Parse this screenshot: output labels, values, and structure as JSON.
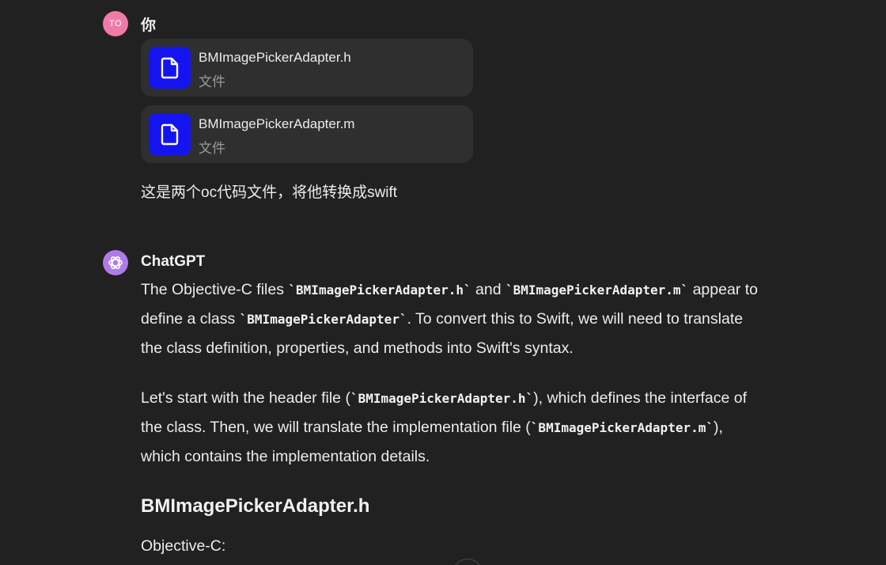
{
  "user_message": {
    "avatar_initials": "TO",
    "author": "你",
    "files": [
      {
        "name": "BMImagePickerAdapter.h",
        "type": "文件",
        "icon": "document-icon"
      },
      {
        "name": "BMImagePickerAdapter.m",
        "type": "文件",
        "icon": "document-icon"
      }
    ],
    "text": "这是两个oc代码文件，将他转换成swift"
  },
  "assistant_message": {
    "author": "ChatGPT",
    "avatar_icon": "openai-logo-icon",
    "p1": {
      "s1": "The Objective-C files ",
      "c1": "`BMImagePickerAdapter.h`",
      "s2": " and ",
      "c2": "`BMImagePickerAdapter.m`",
      "s3": " appear to define a class ",
      "c3": "`BMImagePickerAdapter`",
      "s4": ". To convert this to Swift, we will need to translate the class definition, properties, and methods into Swift's syntax."
    },
    "p2": {
      "s1": "Let's start with the header file (",
      "c1": "`BMImagePickerAdapter.h`",
      "s2": "), which defines the interface of the class. Then, we will translate the implementation file (",
      "c2": "`BMImagePickerAdapter.m`",
      "s3": "), which contains the implementation details."
    },
    "heading": "BMImagePickerAdapter.h",
    "subtext": "Objective-C:"
  },
  "colors": {
    "background": "#212121",
    "file_card": "#2f2f2f",
    "file_icon": "#1414f0",
    "user_avatar": "#f07ba8",
    "gpt_avatar": "#b07be6"
  }
}
